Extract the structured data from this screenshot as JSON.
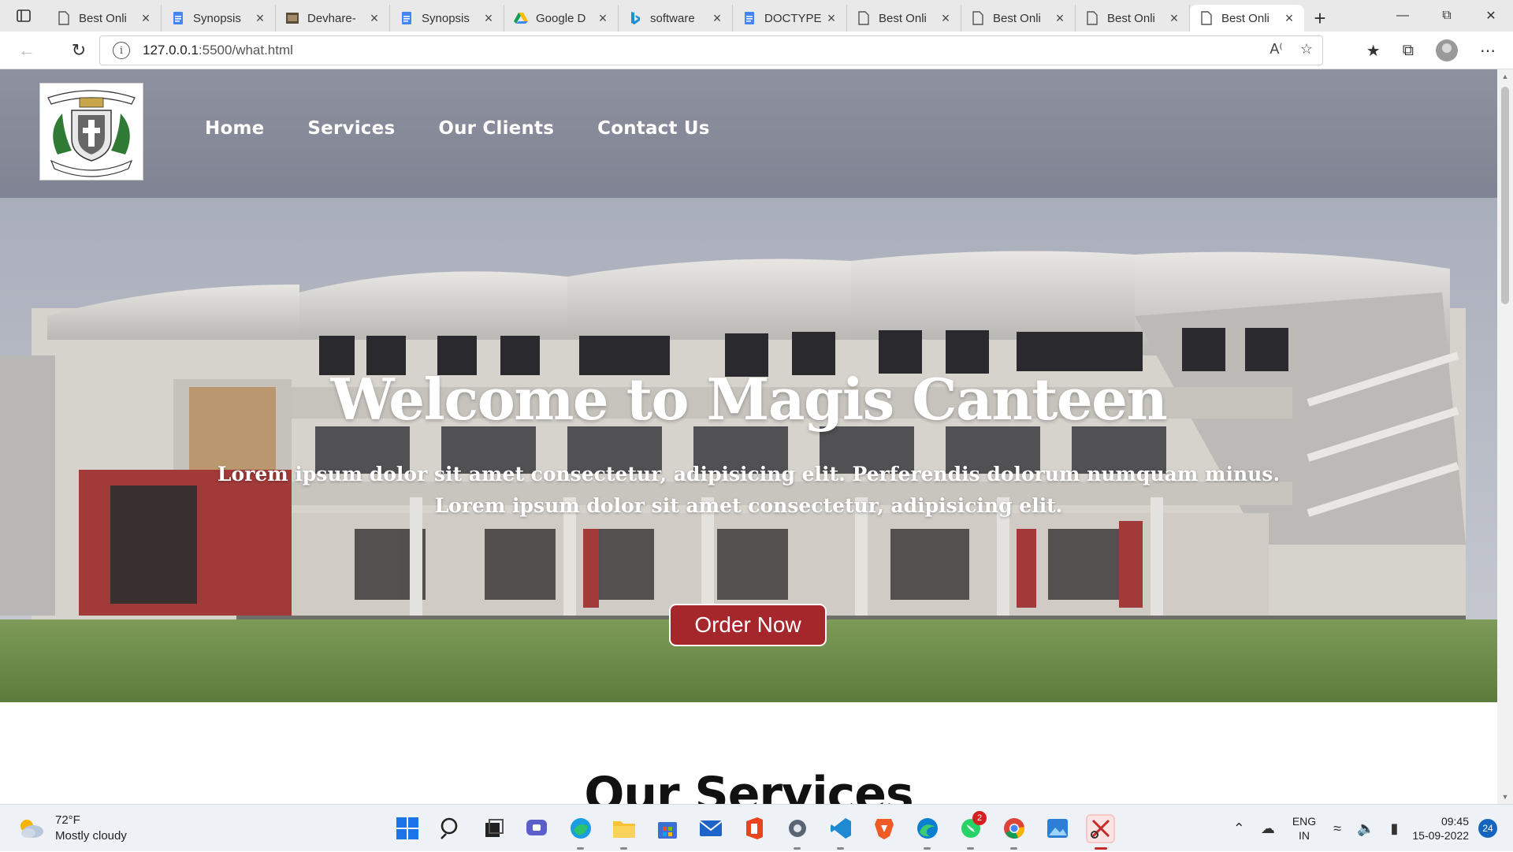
{
  "browser": {
    "tabs": [
      {
        "title": "Best Onli",
        "icon": "page-icon"
      },
      {
        "title": "Synopsis",
        "icon": "docs-icon"
      },
      {
        "title": "Devhare-",
        "icon": "image-icon"
      },
      {
        "title": "Synopsis",
        "icon": "docs-icon"
      },
      {
        "title": "Google D",
        "icon": "drive-icon"
      },
      {
        "title": "software",
        "icon": "bing-icon"
      },
      {
        "title": "DOCTYPE",
        "icon": "docs-icon"
      },
      {
        "title": "Best Onli",
        "icon": "page-icon"
      },
      {
        "title": "Best Onli",
        "icon": "page-icon"
      },
      {
        "title": "Best Onli",
        "icon": "page-icon"
      },
      {
        "title": "Best Onli",
        "icon": "page-icon",
        "active": true
      }
    ],
    "url_host": "127.0.0.1",
    "url_path": ":5500/what.html"
  },
  "site": {
    "nav": [
      "Home",
      "Services",
      "Our Clients",
      "Contact Us"
    ],
    "logo_text": "ST. JOSEPH'S COLLEGE",
    "logo_motto": "FIDE ET LABORE",
    "hero_title": "Welcome to Magis Canteen",
    "hero_line1": "Lorem ipsum dolor sit amet consectetur, adipisicing elit. Perferendis dolorum numquam minus.",
    "hero_line2": "Lorem ipsum dolor sit amet consectetur, adipisicing elit.",
    "order_button": "Order Now",
    "services_title": "Our Services",
    "colors": {
      "header": "#8e929f",
      "button": "#a5272b"
    }
  },
  "taskbar": {
    "temperature": "72°F",
    "condition": "Mostly cloudy",
    "lang_top": "ENG",
    "lang_bottom": "IN",
    "time": "09:45",
    "date": "15-09-2022",
    "notifications": "24",
    "whatsapp_badge": "2"
  }
}
